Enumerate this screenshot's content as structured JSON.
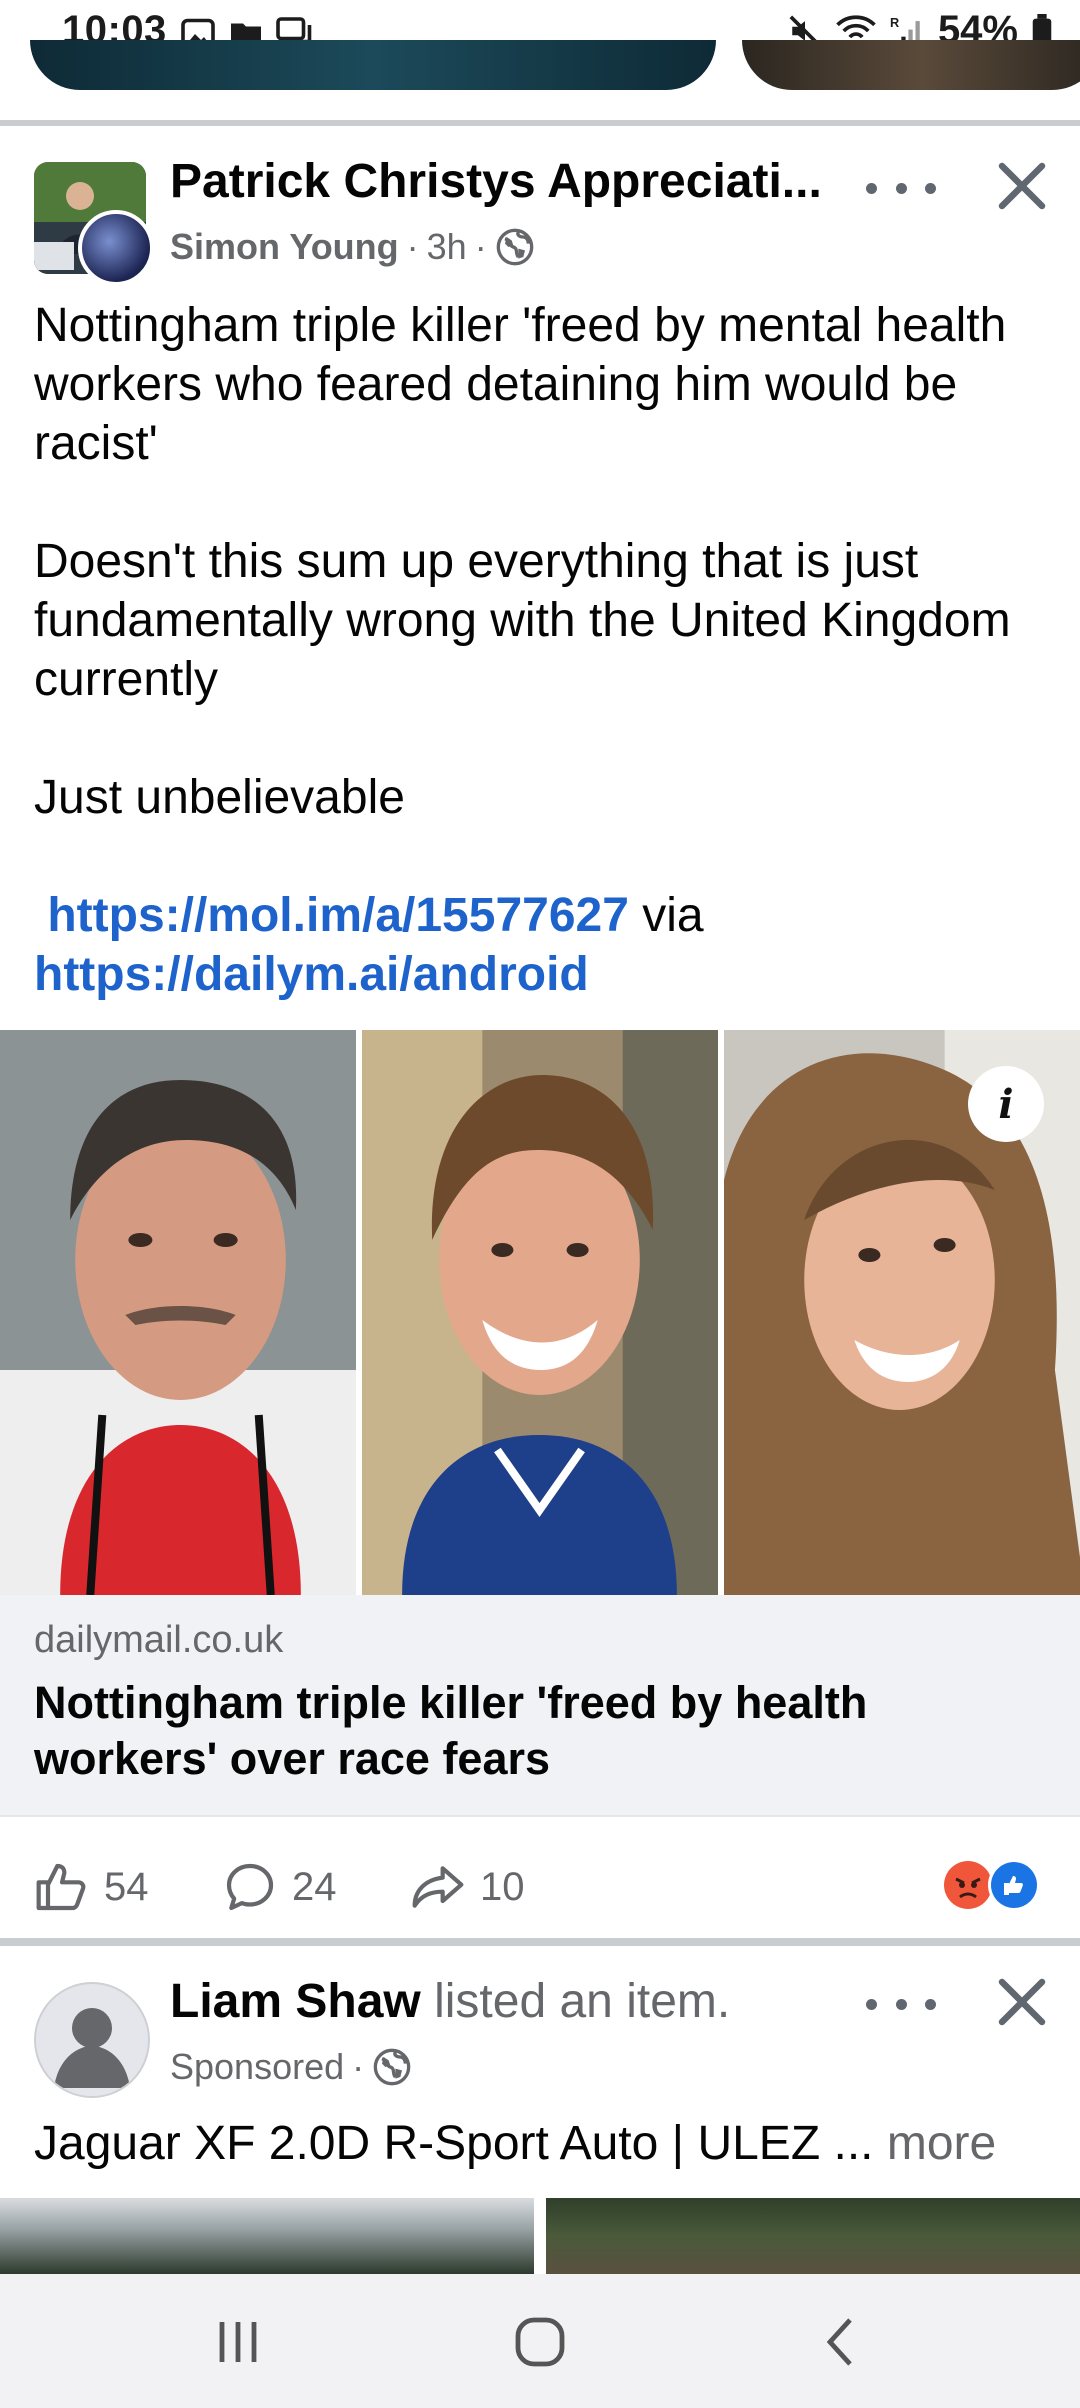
{
  "status_bar": {
    "time": "10:03",
    "battery_percent": "54%",
    "icons_left": [
      "image-icon",
      "folder-icon",
      "chat-icon"
    ],
    "icons_right": [
      "mute-icon",
      "wifi-icon",
      "signal-icon",
      "battery-icon"
    ]
  },
  "post": {
    "page_name": "Patrick Christys Appreciati...",
    "author": "Simon Young",
    "time": "3h",
    "visibility_icon": "globe-icon",
    "text": {
      "para1": "Nottingham triple killer 'freed by mental health workers who feared detaining him would be racist'",
      "para2": "Doesn't this sum up everything that is just fundamentally wrong with the United Kingdom currently",
      "para3": "Just unbelievable",
      "link1": "https://mol.im/a/15577627",
      "via": "via",
      "link2": "https://dailym.ai/android"
    },
    "info_badge": "i",
    "link_preview": {
      "domain": "dailymail.co.uk",
      "title": "Nottingham triple killer 'freed by health workers' over race fears"
    },
    "actions": {
      "likes": "54",
      "comments": "24",
      "shares": "10"
    },
    "reaction_icons": [
      "angry-reaction-icon",
      "like-reaction-icon"
    ]
  },
  "post2": {
    "name": "Liam Shaw",
    "action": "listed an item.",
    "sponsored": "Sponsored",
    "text": "Jaguar XF 2.0D R-Sport Auto | ULEZ ...",
    "more": "more"
  },
  "colors": {
    "link": "#1e63cc",
    "secondary_text": "#65676b",
    "divider": "#c9ccd1",
    "preview_bg": "#f0f2f5"
  }
}
